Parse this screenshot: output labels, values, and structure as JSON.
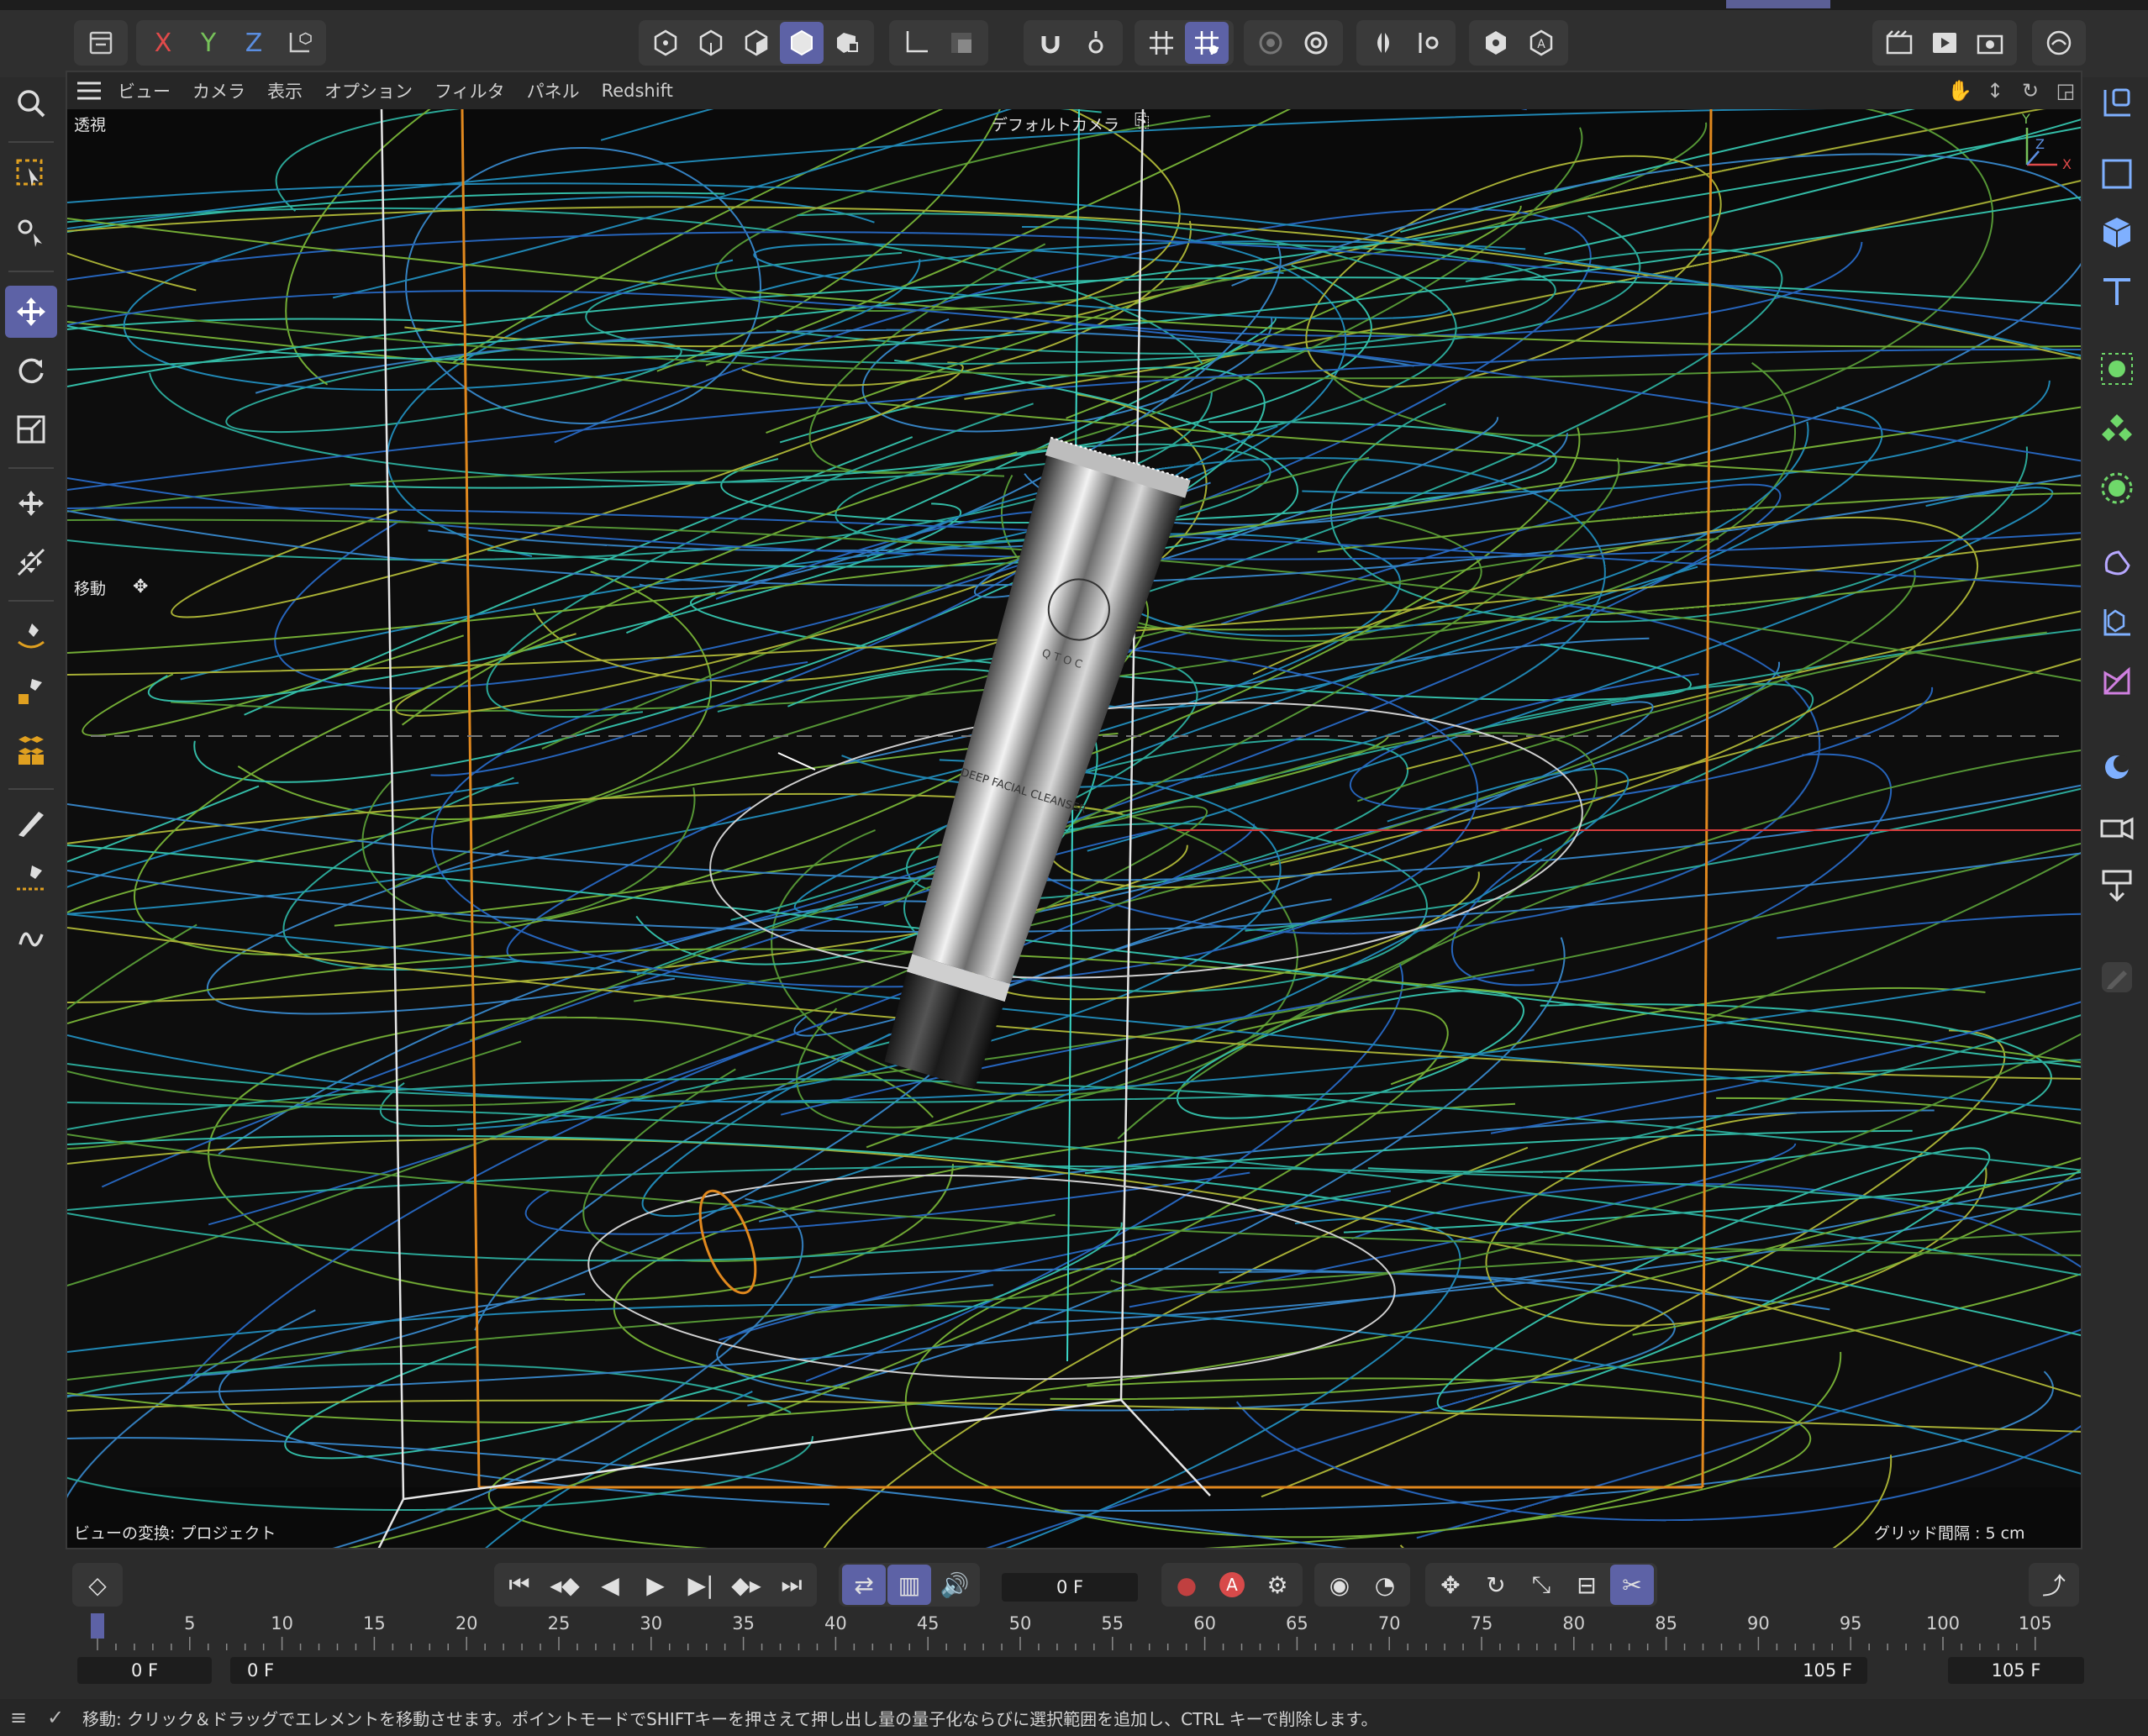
{
  "toolbar": {
    "axis_x": "X",
    "axis_y": "Y",
    "axis_z": "Z"
  },
  "viewport_menu": {
    "items": [
      "ビュー",
      "カメラ",
      "表示",
      "オプション",
      "フィルタ",
      "パネル",
      "Redshift"
    ]
  },
  "viewport": {
    "projection_label": "透視",
    "camera_label": "デフォルトカメラ",
    "tool_label": "移動",
    "view_transform": "ビューの変換: プロジェクト",
    "grid_spacing": "グリッド間隔 : 5 cm",
    "axis_gizmo": {
      "y": "Y",
      "z": "Z",
      "x": "X"
    }
  },
  "product": {
    "brand": "QTOC",
    "text": "DEEP FACIAL CLEANSER"
  },
  "timeline": {
    "current_frame": "0 F",
    "ruler_ticks": [
      "0",
      "5",
      "10",
      "15",
      "20",
      "25",
      "30",
      "35",
      "40",
      "45",
      "50",
      "55",
      "60",
      "65",
      "70",
      "75",
      "80",
      "85",
      "90",
      "95",
      "100",
      "105"
    ],
    "range_start": "0 F",
    "range_start_inner": "0 F",
    "range_end_inner": "105 F",
    "range_end": "105 F"
  },
  "status": {
    "message": "移動: クリック＆ドラッグでエレメントを移動させます。ポイントモードでSHIFTキーを押さえて押し出し量の量子化ならびに選択範囲を追加し、CTRL キーで削除します。"
  },
  "colors": {
    "accent": "#5d62a6",
    "axis_x": "#e04a4a",
    "axis_y": "#77c25a",
    "axis_z": "#5a8de0",
    "orange_box": "#e0881e"
  }
}
